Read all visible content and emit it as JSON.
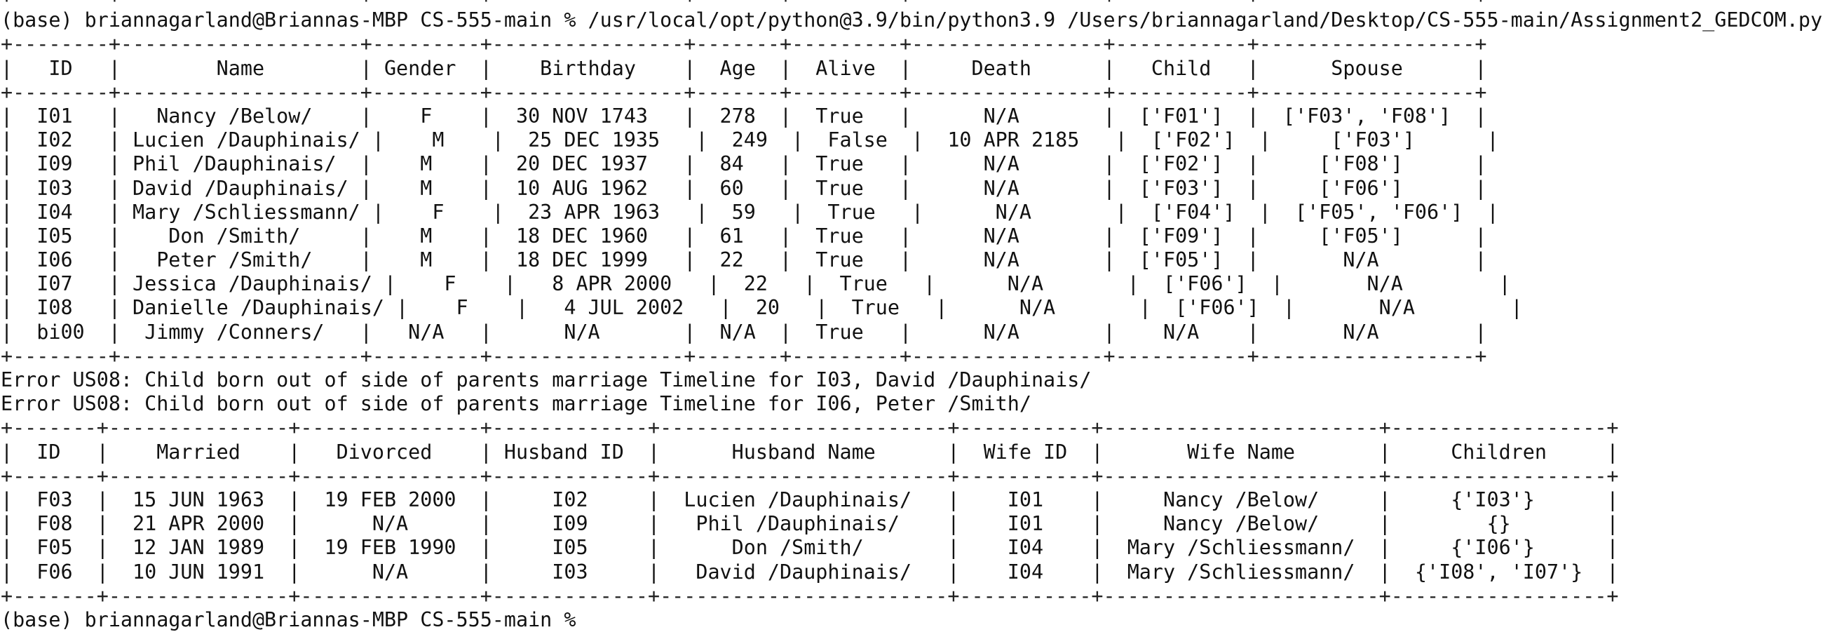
{
  "terminal": {
    "prompt_user": "(base) briannagarland@Briannas-MBP CS-555-main %",
    "command": "/usr/local/opt/python@3.9/bin/python3.9 /Users/briannagarland/Desktop/CS-555-main/Assignment2_GEDCOM.py",
    "next_prompt": "(base) briannagarland@Briannas-MBP CS-555-main %"
  },
  "individuals": {
    "widths": [
      6,
      18,
      7,
      14,
      5,
      7,
      14,
      9,
      16
    ],
    "aligns": [
      "c",
      "c",
      "c",
      "c",
      "c",
      "c",
      "c",
      "c",
      "c"
    ],
    "headers": [
      "ID",
      "Name",
      "Gender",
      "Birthday",
      "Age",
      "Alive",
      "Death",
      "Child",
      "Spouse"
    ],
    "rows": [
      [
        "I01",
        "Nancy /Below/",
        "F",
        "30 NOV 1743",
        "278",
        "True",
        "N/A",
        "['F01']",
        "['F03', 'F08']"
      ],
      [
        "I02",
        "Lucien /Dauphinais/",
        "M",
        "25 DEC 1935",
        "249",
        "False",
        "10 APR 2185",
        "['F02']",
        "['F03']"
      ],
      [
        "I09",
        "Phil /Dauphinais/",
        "M",
        "20 DEC 1937",
        "84",
        "True",
        "N/A",
        "['F02']",
        "['F08']"
      ],
      [
        "I03",
        "David /Dauphinais/",
        "M",
        "10 AUG 1962",
        "60",
        "True",
        "N/A",
        "['F03']",
        "['F06']"
      ],
      [
        "I04",
        "Mary /Schliessmann/",
        "F",
        "23 APR 1963",
        "59",
        "True",
        "N/A",
        "['F04']",
        "['F05', 'F06']"
      ],
      [
        "I05",
        "Don /Smith/",
        "M",
        "18 DEC 1960",
        "61",
        "True",
        "N/A",
        "['F09']",
        "['F05']"
      ],
      [
        "I06",
        "Peter /Smith/",
        "M",
        "18 DEC 1999",
        "22",
        "True",
        "N/A",
        "['F05']",
        "N/A"
      ],
      [
        "I07",
        "Jessica /Dauphinais/",
        "F",
        "8 APR 2000",
        "22",
        "True",
        "N/A",
        "['F06']",
        "N/A"
      ],
      [
        "I08",
        "Danielle /Dauphinais/",
        "F",
        "4 JUL 2002",
        "20",
        "True",
        "N/A",
        "['F06']",
        "N/A"
      ],
      [
        "bi00",
        "Jimmy /Conners/",
        "N/A",
        "N/A",
        "N/A",
        "True",
        "N/A",
        "N/A",
        "N/A"
      ]
    ]
  },
  "errors": [
    "Error US08: Child born out of side of parents marriage Timeline for I03, David /Dauphinais/",
    "Error US08: Child born out of side of parents marriage Timeline for I06, Peter /Smith/"
  ],
  "families": {
    "widths": [
      5,
      13,
      13,
      11,
      22,
      9,
      21,
      16
    ],
    "aligns": [
      "c",
      "c",
      "c",
      "c",
      "c",
      "c",
      "c",
      "c"
    ],
    "headers": [
      "ID",
      "Married",
      "Divorced",
      "Husband ID",
      "Husband Name",
      "Wife ID",
      "Wife Name",
      "Children"
    ],
    "rows": [
      [
        "F03",
        "15 JUN 1963",
        "19 FEB 2000",
        "I02",
        "Lucien /Dauphinais/",
        "I01",
        "Nancy /Below/",
        "{'I03'}"
      ],
      [
        "F08",
        "21 APR 2000",
        "N/A",
        "I09",
        "Phil /Dauphinais/",
        "I01",
        "Nancy /Below/",
        "{}"
      ],
      [
        "F05",
        "12 JAN 1989",
        "19 FEB 1990",
        "I05",
        "Don /Smith/",
        "I04",
        "Mary /Schliessmann/",
        "{'I06'}"
      ],
      [
        "F06",
        "10 JUN 1991",
        "N/A",
        "I03",
        "David /Dauphinais/",
        "I04",
        "Mary /Schliessmann/",
        "{'I08', 'I07'}"
      ]
    ]
  }
}
